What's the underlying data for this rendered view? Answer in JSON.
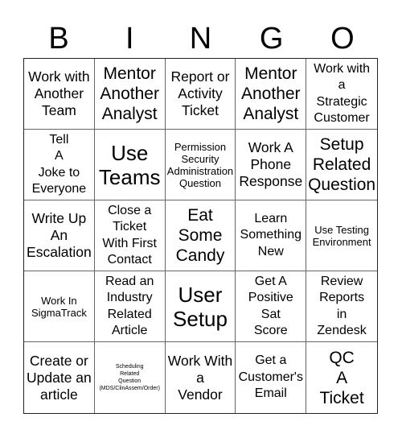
{
  "header": {
    "letters": [
      "B",
      "I",
      "N",
      "G",
      "O"
    ]
  },
  "cells": [
    {
      "text": "Work with\nAnother\nTeam",
      "size": "m"
    },
    {
      "text": "Mentor\nAnother\nAnalyst",
      "size": "l"
    },
    {
      "text": "Report or\nActivity\nTicket",
      "size": "m"
    },
    {
      "text": "Mentor\nAnother\nAnalyst",
      "size": "l"
    },
    {
      "text": "Work with\na\nStrategic\nCustomer",
      "size": "ms"
    },
    {
      "text": "Tell\nA\nJoke to\nEveryone",
      "size": "ms"
    },
    {
      "text": "Use\nTeams",
      "size": "xl"
    },
    {
      "text": "Permission\nSecurity\nAdministration\nQuestion",
      "size": "s"
    },
    {
      "text": "Work A\nPhone\nResponse",
      "size": "m"
    },
    {
      "text": "Setup\nRelated\nQuestion",
      "size": "l"
    },
    {
      "text": "Write Up\nAn\nEscalation",
      "size": "m"
    },
    {
      "text": "Close a\nTicket\nWith First\nContact",
      "size": "ms"
    },
    {
      "text": "Eat\nSome\nCandy",
      "size": "l"
    },
    {
      "text": "Learn\nSomething\nNew",
      "size": "ms"
    },
    {
      "text": "Use Testing\nEnvironment",
      "size": "s"
    },
    {
      "text": "Work In\nSigmaTrack",
      "size": "s"
    },
    {
      "text": "Read an\nIndustry\nRelated\nArticle",
      "size": "ms"
    },
    {
      "text": "User\nSetup",
      "size": "xl"
    },
    {
      "text": "Get A\nPositive\nSat\nScore",
      "size": "ms"
    },
    {
      "text": "Review\nReports\nin\nZendesk",
      "size": "ms"
    },
    {
      "text": "Create or\nUpdate an\narticle",
      "size": "m"
    },
    {
      "text": "Scheduling\nRelated\nQuestion\n(MDS/ClinAssem/Order)",
      "size": "xs"
    },
    {
      "text": "Work With\na\nVendor",
      "size": "m"
    },
    {
      "text": "Get a\nCustomer's\nEmail",
      "size": "ms"
    },
    {
      "text": "QC\nA\nTicket",
      "size": "l"
    }
  ]
}
